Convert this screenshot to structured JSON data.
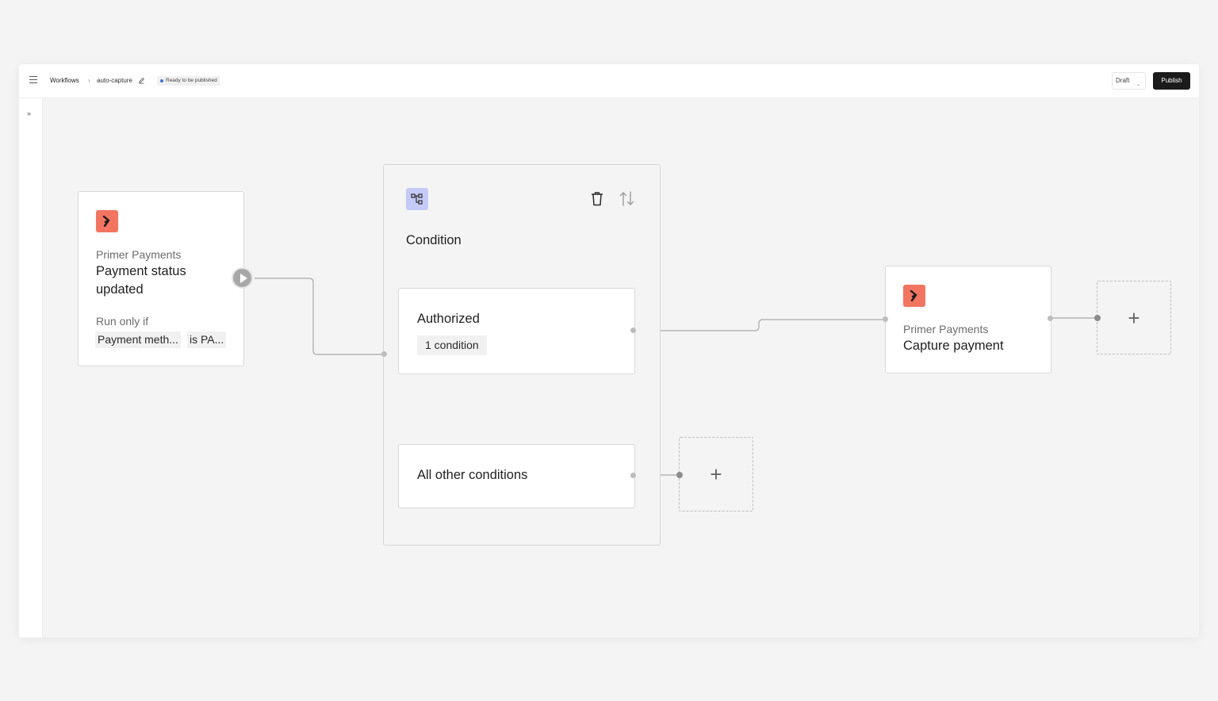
{
  "header": {
    "breadcrumb_root": "Workflows",
    "breadcrumb_sep": "›",
    "workflow_name": "auto-capture",
    "status_badge": "Ready to be published",
    "draft_label": "Draft",
    "publish_label": "Publish"
  },
  "trigger_node": {
    "provider": "Primer Payments",
    "title": "Payment status updated",
    "run_only_if": "Run only if",
    "condition_field": "Payment meth...",
    "condition_value": "is PA..."
  },
  "condition_group": {
    "title": "Condition",
    "branches": [
      {
        "title": "Authorized",
        "badge": "1 condition"
      },
      {
        "title": "All other conditions"
      }
    ]
  },
  "action_node": {
    "provider": "Primer Payments",
    "title": "Capture payment"
  },
  "add_step": {
    "plus": "+"
  },
  "colors": {
    "publish_bg": "#1b1b1b",
    "provider_icon_bg": "#f27561",
    "condition_icon_bg": "#c5cbf7"
  }
}
